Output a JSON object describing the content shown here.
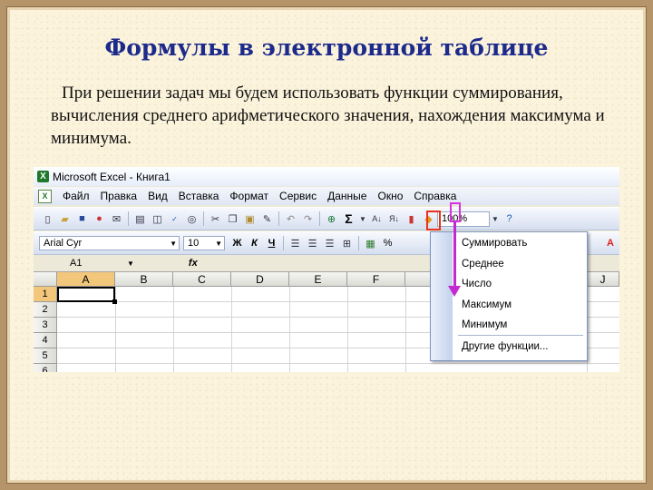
{
  "slide": {
    "title": "Формулы в электронной таблице",
    "text": "При решении задач мы будем использовать функции суммирования, вычисления среднего арифметического значения, нахождения максимума и минимума."
  },
  "excel": {
    "window_title": "Microsoft Excel - Книга1",
    "menu": [
      "Файл",
      "Правка",
      "Вид",
      "Вставка",
      "Формат",
      "Сервис",
      "Данные",
      "Окно",
      "Справка"
    ],
    "zoom": "100%",
    "font_name": "Arial Cyr",
    "font_size": "10",
    "format_buttons": {
      "bold": "Ж",
      "italic": "К",
      "underline": "Ч",
      "percent": "%"
    },
    "sigma": "Σ",
    "name_box": "A1",
    "fx": "fx",
    "columns": [
      "A",
      "B",
      "C",
      "D",
      "E",
      "F",
      "J"
    ],
    "rows": [
      "1",
      "2",
      "3",
      "4",
      "5",
      "6"
    ],
    "autosum_menu": [
      "Суммировать",
      "Среднее",
      "Число",
      "Максимум",
      "Минимум",
      "Другие функции..."
    ]
  },
  "colors": {
    "title": "#1c2a8c",
    "highlight_red": "#e8321e",
    "highlight_magenta": "#c428d0"
  }
}
